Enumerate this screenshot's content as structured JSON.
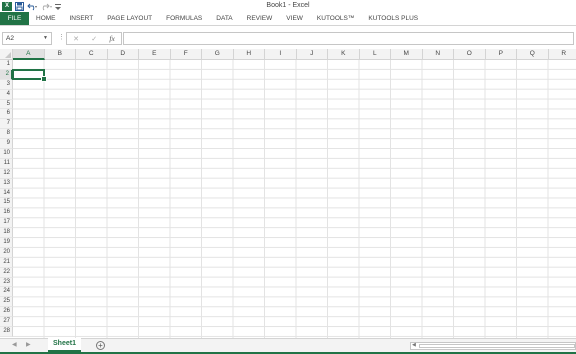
{
  "window": {
    "title": "Book1 - Excel"
  },
  "quick_access": {
    "logo_letter": "X",
    "icons": [
      "excel-logo-icon",
      "save-icon",
      "undo-icon",
      "redo-icon",
      "customize-qat-icon"
    ]
  },
  "ribbon": {
    "tabs": [
      "FILE",
      "HOME",
      "INSERT",
      "PAGE LAYOUT",
      "FORMULAS",
      "DATA",
      "REVIEW",
      "VIEW",
      "KUTOOLS™",
      "KUTOOLS PLUS"
    ]
  },
  "formula_bar": {
    "name_box": "A2",
    "cancel_glyph": "✕",
    "enter_glyph": "✓",
    "fx_label": "fx",
    "value": ""
  },
  "grid": {
    "columns": [
      "A",
      "B",
      "C",
      "D",
      "E",
      "F",
      "G",
      "H",
      "I",
      "J",
      "K",
      "L",
      "M",
      "N",
      "O",
      "P",
      "Q",
      "R"
    ],
    "rows": [
      "1",
      "2",
      "3",
      "4",
      "5",
      "6",
      "7",
      "8",
      "9",
      "10",
      "11",
      "12",
      "13",
      "14",
      "15",
      "16",
      "17",
      "18",
      "19",
      "20",
      "21",
      "22",
      "23",
      "24",
      "25",
      "26",
      "27",
      "28"
    ],
    "selected_column": "A",
    "selected_row": "2"
  },
  "sheets": {
    "tabs": [
      "Sheet1"
    ],
    "active": "Sheet1",
    "add_glyph": "+"
  },
  "colors": {
    "accent": "#217346",
    "gridline": "#e3e3e3",
    "header_bg": "#f3f3f3"
  }
}
